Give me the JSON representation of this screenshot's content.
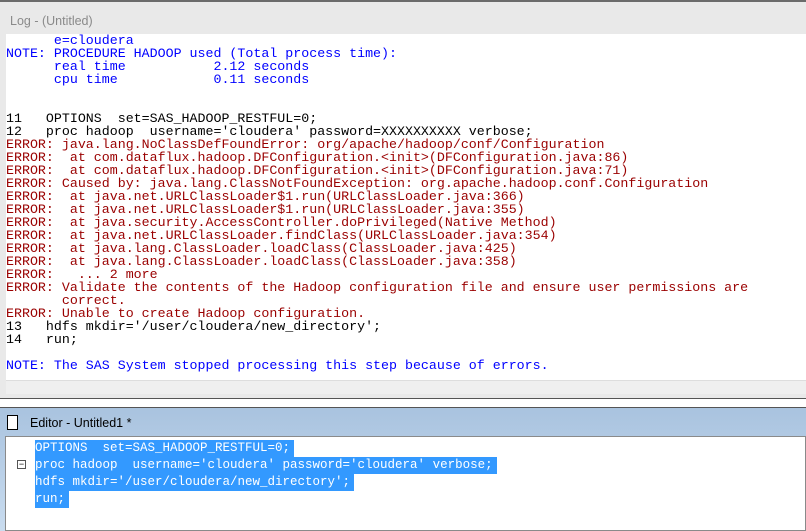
{
  "log": {
    "title": "Log - (Untitled)",
    "lines": [
      {
        "type": "note",
        "text": "      e=cloudera"
      },
      {
        "type": "note",
        "text": "NOTE: PROCEDURE HADOOP used (Total process time):"
      },
      {
        "type": "note",
        "text": "      real time           2.12 seconds"
      },
      {
        "type": "note",
        "text": "      cpu time            0.11 seconds"
      },
      {
        "type": "src",
        "text": ""
      },
      {
        "type": "src",
        "text": ""
      },
      {
        "type": "src",
        "text": "11   OPTIONS  set=SAS_HADOOP_RESTFUL=0;"
      },
      {
        "type": "src",
        "text": "12   proc hadoop  username='cloudera' password=XXXXXXXXXX verbose;"
      },
      {
        "type": "error",
        "text": "ERROR: java.lang.NoClassDefFoundError: org/apache/hadoop/conf/Configuration"
      },
      {
        "type": "error",
        "text": "ERROR:  at com.dataflux.hadoop.DFConfiguration.<init>(DFConfiguration.java:86)"
      },
      {
        "type": "error",
        "text": "ERROR:  at com.dataflux.hadoop.DFConfiguration.<init>(DFConfiguration.java:71)"
      },
      {
        "type": "error",
        "text": "ERROR: Caused by: java.lang.ClassNotFoundException: org.apache.hadoop.conf.Configuration"
      },
      {
        "type": "error",
        "text": "ERROR:  at java.net.URLClassLoader$1.run(URLClassLoader.java:366)"
      },
      {
        "type": "error",
        "text": "ERROR:  at java.net.URLClassLoader$1.run(URLClassLoader.java:355)"
      },
      {
        "type": "error",
        "text": "ERROR:  at java.security.AccessController.doPrivileged(Native Method)"
      },
      {
        "type": "error",
        "text": "ERROR:  at java.net.URLClassLoader.findClass(URLClassLoader.java:354)"
      },
      {
        "type": "error",
        "text": "ERROR:  at java.lang.ClassLoader.loadClass(ClassLoader.java:425)"
      },
      {
        "type": "error",
        "text": "ERROR:  at java.lang.ClassLoader.loadClass(ClassLoader.java:358)"
      },
      {
        "type": "error",
        "text": "ERROR:   ... 2 more"
      },
      {
        "type": "error",
        "text": "ERROR: Validate the contents of the Hadoop configuration file and ensure user permissions are"
      },
      {
        "type": "error",
        "text": "       correct."
      },
      {
        "type": "error",
        "text": "ERROR: Unable to create Hadoop configuration."
      },
      {
        "type": "src",
        "text": "13   hdfs mkdir='/user/cloudera/new_directory';"
      },
      {
        "type": "src",
        "text": "14   run;"
      },
      {
        "type": "src",
        "text": ""
      },
      {
        "type": "note",
        "text": "NOTE: The SAS System stopped processing this step because of errors."
      }
    ]
  },
  "editor": {
    "title": "Editor - Untitled1 *",
    "lines": [
      "OPTIONS  set=SAS_HADOOP_RESTFUL=0;",
      "proc hadoop  username='cloudera' password='cloudera' verbose;",
      "hdfs mkdir='/user/cloudera/new_directory';",
      "run;"
    ]
  }
}
